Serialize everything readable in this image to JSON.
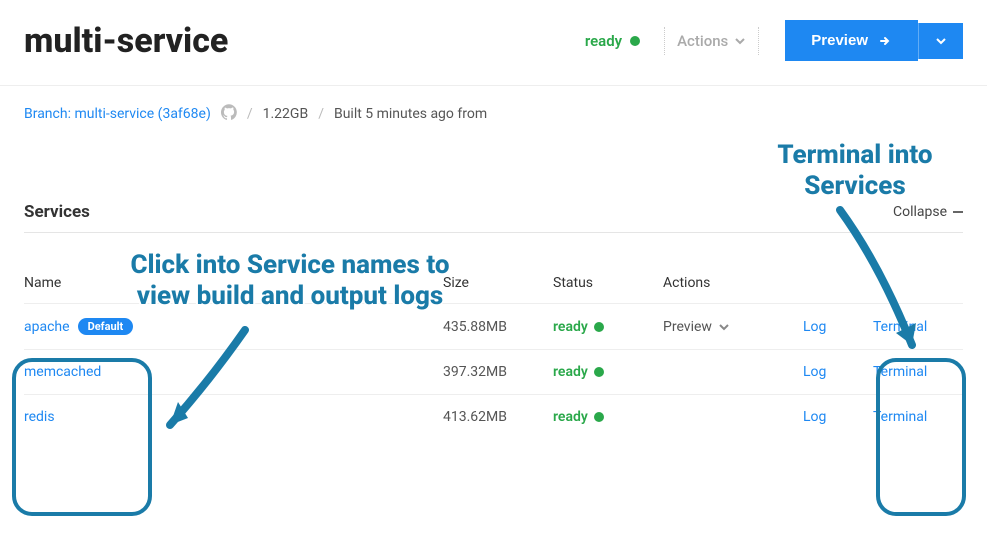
{
  "header": {
    "title": "multi-service",
    "status": "ready",
    "actions_label": "Actions",
    "preview_label": "Preview"
  },
  "meta": {
    "branch_label": "Branch:",
    "branch_name": "multi-service",
    "commit": "3af68e",
    "size": "1.22GB",
    "built": "Built 5 minutes ago from"
  },
  "section": {
    "title": "Services",
    "collapse_label": "Collapse"
  },
  "columns": {
    "name": "Name",
    "size": "Size",
    "status": "Status",
    "actions": "Actions"
  },
  "services": [
    {
      "name": "apache",
      "default": true,
      "default_label": "Default",
      "size": "435.88MB",
      "status": "ready",
      "action": "Preview",
      "log": "Log",
      "terminal": "Terminal"
    },
    {
      "name": "memcached",
      "default": false,
      "default_label": "",
      "size": "397.32MB",
      "status": "ready",
      "action": "",
      "log": "Log",
      "terminal": "Terminal"
    },
    {
      "name": "redis",
      "default": false,
      "default_label": "",
      "size": "413.62MB",
      "status": "ready",
      "action": "",
      "log": "Log",
      "terminal": "Terminal"
    }
  ],
  "annotations": {
    "left": "Click into Service names to\nview build and output logs",
    "right": "Terminal into\nServices"
  }
}
